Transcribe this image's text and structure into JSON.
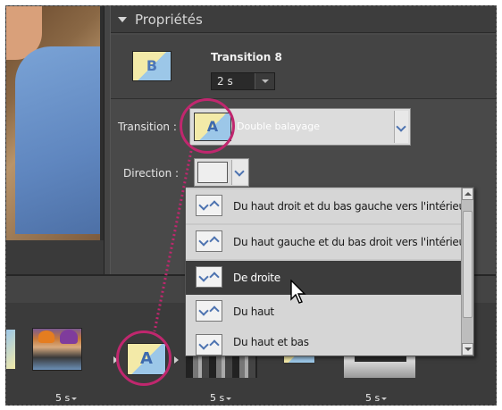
{
  "panel": {
    "title": "Propriétés",
    "transition_name": "Transition 8",
    "duration": "2 s"
  },
  "fields": {
    "transition_label": "Transition :",
    "transition_value": "Double balayage",
    "direction_label": "Direction :"
  },
  "direction_options": [
    {
      "label": "Du haut droit et du bas gauche vers l'intérieur",
      "icon": "diagonal-in-icon"
    },
    {
      "label": "Du haut gauche et du bas droit vers l'intérieur",
      "icon": "diagonal-in-icon"
    },
    {
      "label": "De droite",
      "icon": "from-right-icon",
      "selected": true
    },
    {
      "label": "Du haut",
      "icon": "from-top-icon"
    },
    {
      "label": "Du haut et bas",
      "icon": "top-bottom-icon"
    }
  ],
  "timeline": {
    "clip_durations": [
      "5 s",
      "5 s",
      "5 s"
    ]
  },
  "icon_letters": {
    "thumb": "B",
    "transition": "A"
  },
  "colors": {
    "highlight_circle": "#c0276e",
    "panel_bg": "#494949",
    "selected_row": "#3c3c3c"
  }
}
